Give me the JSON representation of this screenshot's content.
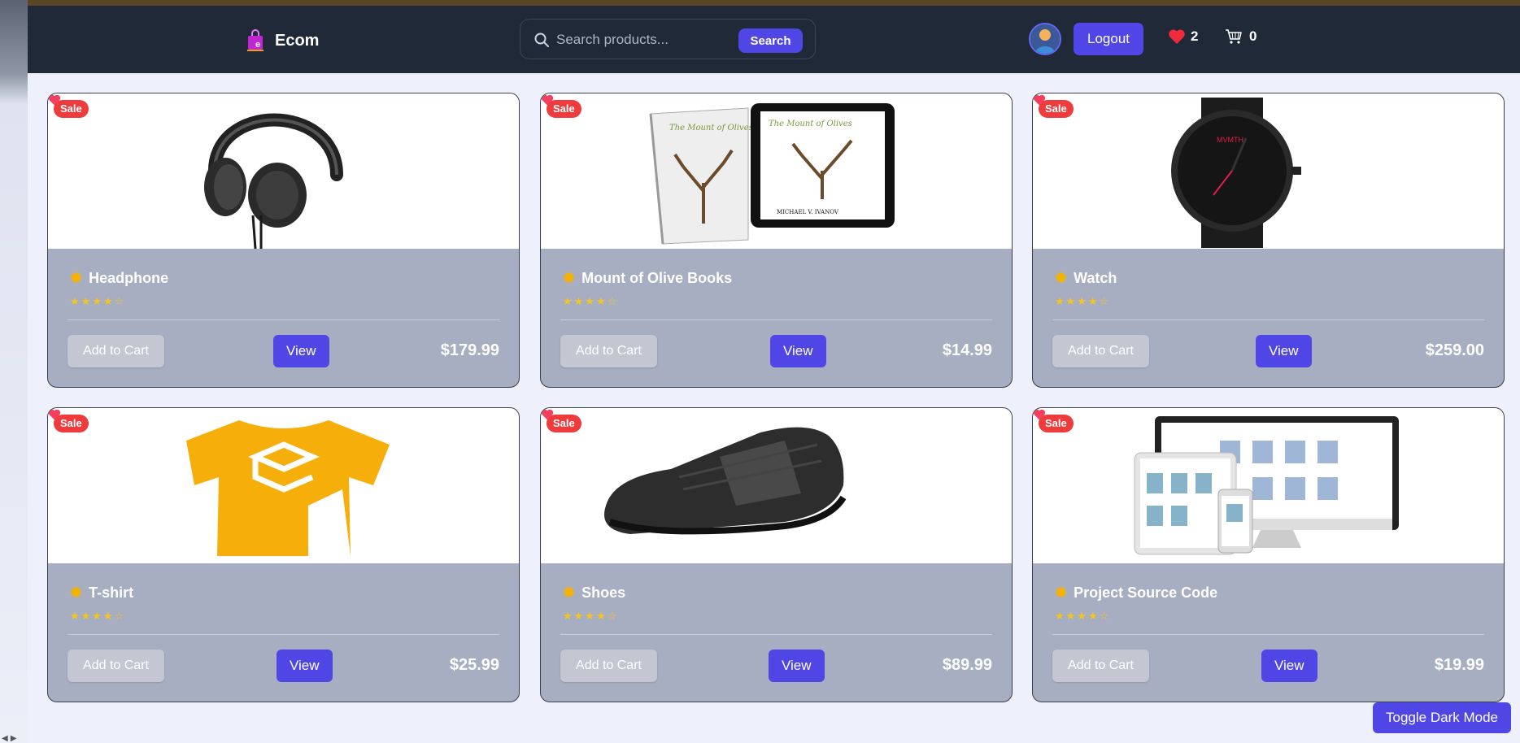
{
  "header": {
    "brand_title": "Ecom",
    "search_placeholder": "Search products...",
    "search_button": "Search",
    "logout_label": "Logout",
    "wishlist_count": "2",
    "cart_count": "0"
  },
  "products": [
    {
      "name": "Headphone",
      "price": "$179.99",
      "badge": "Sale",
      "add_to_cart": "Add to Cart",
      "view": "View",
      "rating": 4.5
    },
    {
      "name": "Mount of Olive Books",
      "price": "$14.99",
      "badge": "Sale",
      "add_to_cart": "Add to Cart",
      "view": "View",
      "rating": 4.5,
      "image_text": {
        "title": "The Mount of Olives",
        "author": "MICHAEL V. IVANOV"
      }
    },
    {
      "name": "Watch",
      "price": "$259.00",
      "badge": "Sale",
      "add_to_cart": "Add to Cart",
      "view": "View",
      "rating": 4.5,
      "image_text": {
        "brand": "MVMTH"
      }
    },
    {
      "name": "T-shirt",
      "price": "$25.99",
      "badge": "Sale",
      "add_to_cart": "Add to Cart",
      "view": "View",
      "rating": 4.5
    },
    {
      "name": "Shoes",
      "price": "$89.99",
      "badge": "Sale",
      "add_to_cart": "Add to Cart",
      "view": "View",
      "rating": 4.5
    },
    {
      "name": "Project Source Code",
      "price": "$19.99",
      "badge": "Sale",
      "add_to_cart": "Add to Cart",
      "view": "View",
      "rating": 4.5
    }
  ],
  "toggle_dark_mode": "Toggle Dark Mode",
  "colors": {
    "navbar": "#1f2937",
    "accent": "#4f46e5",
    "sale": "#ef3b3b",
    "card_body": "#a8aec2",
    "star": "#f5c518",
    "heart": "#f43f5e"
  }
}
